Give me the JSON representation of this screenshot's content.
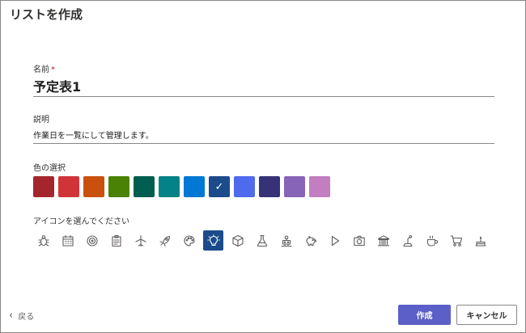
{
  "dialog": {
    "title": "リストを作成"
  },
  "name_field": {
    "label": "名前",
    "required_mark": "*",
    "value": "予定表1"
  },
  "description_field": {
    "label": "説明",
    "value": "作業日を一覧にして管理します。"
  },
  "color_section": {
    "label": "色の選択",
    "colors": [
      "#a4262c",
      "#d13438",
      "#ca5010",
      "#498205",
      "#005e50",
      "#038387",
      "#0078d4",
      "#1c4b8c",
      "#4f6bed",
      "#373277",
      "#8764b8",
      "#c27ec1"
    ],
    "selected_index": 7,
    "check_mark": "✓"
  },
  "icon_section": {
    "label": "アイコンを選んでください",
    "icons": [
      "bug-icon",
      "calendar-icon",
      "target-icon",
      "clipboard-icon",
      "airplane-icon",
      "rocket-icon",
      "palette-icon",
      "lightbulb-icon",
      "cube-icon",
      "flask-icon",
      "robot-icon",
      "piggybank-icon",
      "play-icon",
      "camera-icon",
      "bank-icon",
      "lever-icon",
      "coffee-icon",
      "cart-icon",
      "cake-icon"
    ],
    "selected_index": 7
  },
  "footer": {
    "back_label": "戻る",
    "create_label": "作成",
    "cancel_label": "キャンセル"
  }
}
